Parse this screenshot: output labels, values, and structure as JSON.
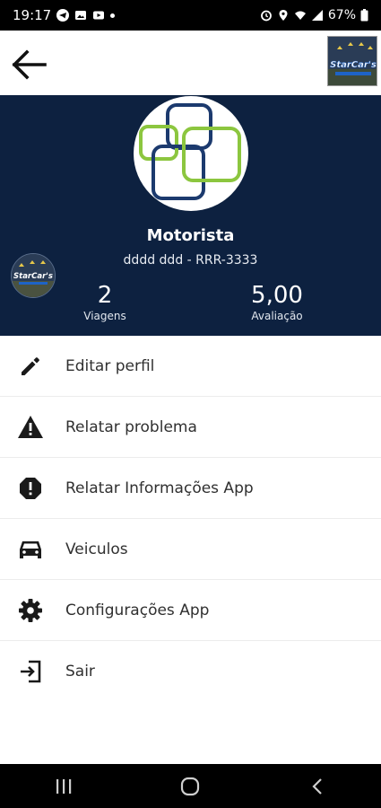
{
  "status_bar": {
    "time": "19:17",
    "battery": "67%",
    "icons": [
      "telegram-icon",
      "gallery-icon",
      "youtube-icon",
      "alarm-icon",
      "location-icon",
      "wifi-icon",
      "signal-icon",
      "battery-icon"
    ]
  },
  "app_bar": {
    "back_icon": "arrow-left-icon",
    "logo_text": "StarCar's"
  },
  "profile": {
    "name": "Motorista",
    "subtitle": "dddd ddd - RRR-3333",
    "logo_text": "StarCar's",
    "stats": {
      "trips_value": "2",
      "trips_label": "Viagens",
      "rating_value": "5,00",
      "rating_label": "Avaliação"
    }
  },
  "menu": [
    {
      "label": "Editar perfil",
      "icon": "pencil-icon"
    },
    {
      "label": "Relatar problema",
      "icon": "warning-icon"
    },
    {
      "label": "Relatar Informações App",
      "icon": "alert-octagon-icon"
    },
    {
      "label": "Veiculos",
      "icon": "car-icon"
    },
    {
      "label": "Configurações App",
      "icon": "gear-icon"
    },
    {
      "label": "Sair",
      "icon": "logout-icon"
    }
  ],
  "colors": {
    "header_bg": "#0d2140",
    "logo_blue": "#1c3a6e",
    "logo_green": "#8cc63f"
  }
}
